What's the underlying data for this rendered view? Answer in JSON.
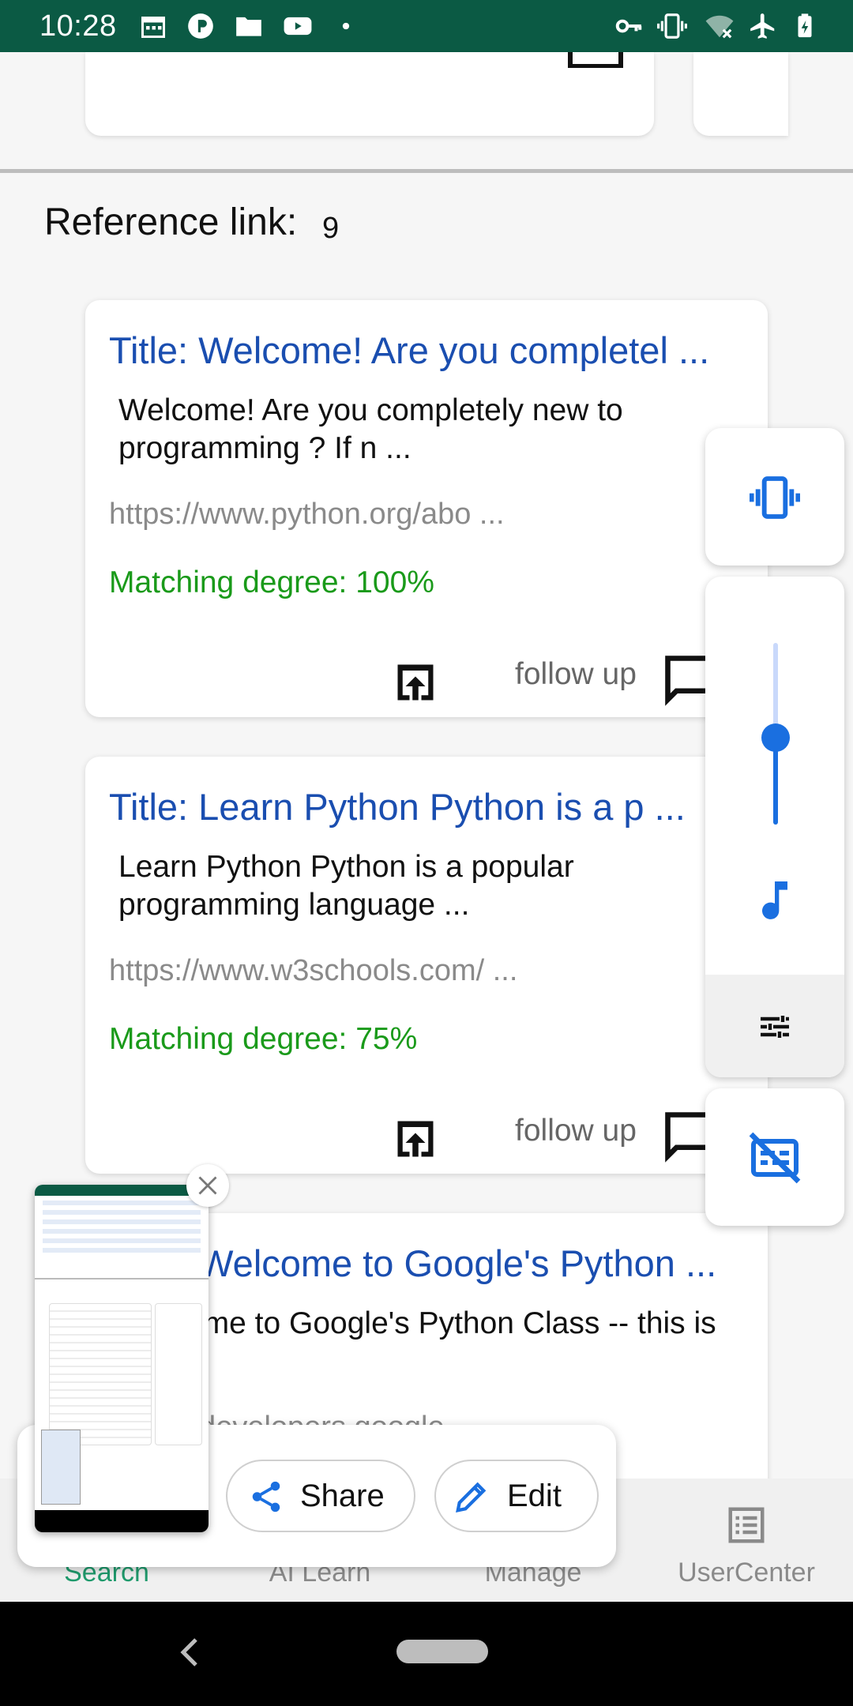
{
  "status_bar": {
    "time": "10:28",
    "icons": [
      "calendar-icon",
      "app-icon",
      "folder-icon",
      "youtube-icon",
      "dot-icon",
      "key-icon",
      "vibrate-icon",
      "wifi-off-icon",
      "airplane-icon",
      "battery-icon"
    ]
  },
  "reference": {
    "label": "Reference link:",
    "count": "9"
  },
  "results": [
    {
      "title": "Title: Welcome! Are you completel ...",
      "snippet": "Welcome! Are you completely new to programming ? If n ...",
      "url": "https://www.python.org/abo ...",
      "match": "Matching degree: 100%",
      "followup": "follow up"
    },
    {
      "title": "Title: Learn Python Python is a p ...",
      "snippet": "Learn Python Python is a popular programming language ...",
      "url": "https://www.w3schools.com/ ...",
      "match": "Matching degree: 75%",
      "followup": "follow up"
    },
    {
      "title": "Title: Welcome to Google's Python ...",
      "snippet": "Welcome to Google's Python Class -- this is a ...",
      "url": "https://developers.google ..."
    }
  ],
  "volume": {
    "level": 0.48
  },
  "screenshot": {
    "share_label": "Share",
    "edit_label": "Edit"
  },
  "nav": {
    "items": [
      "Search",
      "AI Learn",
      "Manage",
      "UserCenter"
    ]
  },
  "colors": {
    "status_bar": "#0b5a44",
    "title_blue": "#1a4eb0",
    "match_green": "#1a9a1a",
    "accent_blue": "#1a6fe0",
    "nav_active": "#1f9a6c"
  }
}
